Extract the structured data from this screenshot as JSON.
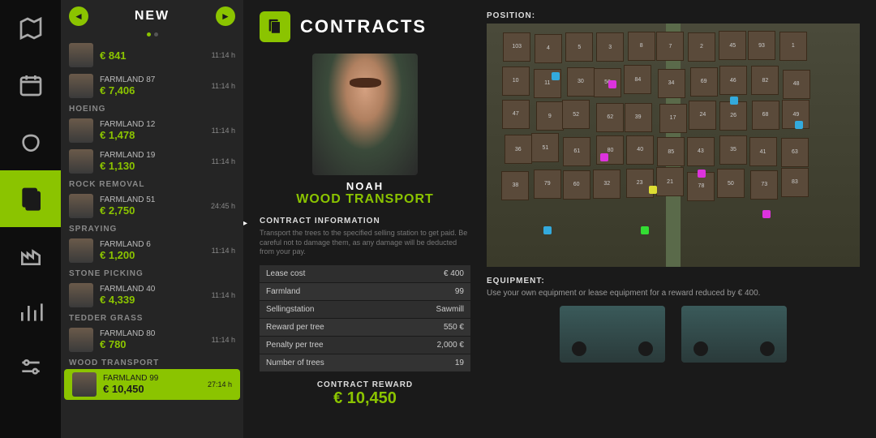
{
  "sidebar": {
    "title": "NEW",
    "categories": [
      {
        "name": "",
        "items": [
          {
            "farmland": "€ 841",
            "price": "",
            "time": "11:14 h",
            "hideName": true
          }
        ]
      },
      {
        "name": "",
        "items": [
          {
            "farmland": "FARMLAND 87",
            "price": "€ 7,406",
            "time": "11:14 h"
          }
        ]
      },
      {
        "name": "HOEING",
        "items": [
          {
            "farmland": "FARMLAND 12",
            "price": "€ 1,478",
            "time": "11:14 h"
          },
          {
            "farmland": "FARMLAND 19",
            "price": "€ 1,130",
            "time": "11:14 h"
          }
        ]
      },
      {
        "name": "ROCK REMOVAL",
        "items": [
          {
            "farmland": "FARMLAND 51",
            "price": "€ 2,750",
            "time": "24:45 h"
          }
        ]
      },
      {
        "name": "SPRAYING",
        "items": [
          {
            "farmland": "FARMLAND 6",
            "price": "€ 1,200",
            "time": "11:14 h"
          }
        ]
      },
      {
        "name": "STONE PICKING",
        "items": [
          {
            "farmland": "FARMLAND 40",
            "price": "€ 4,339",
            "time": "11:14 h"
          }
        ]
      },
      {
        "name": "TEDDER GRASS",
        "items": [
          {
            "farmland": "FARMLAND 80",
            "price": "€ 780",
            "time": "11:14 h"
          }
        ]
      },
      {
        "name": "WOOD TRANSPORT",
        "items": [
          {
            "farmland": "FARMLAND 99",
            "price": "€ 10,450",
            "time": "27:14 h",
            "selected": true
          }
        ]
      }
    ]
  },
  "page": {
    "title": "CONTRACTS"
  },
  "contract": {
    "npc": "NOAH",
    "job": "WOOD TRANSPORT",
    "info_heading": "CONTRACT INFORMATION",
    "description": "Transport the trees to the specified selling station to get paid. Be careful not to damage them, as any damage will be deducted from your pay.",
    "rows": [
      {
        "k": "Lease cost",
        "v": "€ 400"
      },
      {
        "k": "Farmland",
        "v": "99"
      },
      {
        "k": "Sellingstation",
        "v": "Sawmill"
      },
      {
        "k": "Reward per tree",
        "v": "550 €"
      },
      {
        "k": "Penalty per tree",
        "v": "2,000 €"
      },
      {
        "k": "Number of trees",
        "v": "19"
      }
    ],
    "reward_label": "CONTRACT REWARD",
    "reward_value": "€ 10,450"
  },
  "position": {
    "heading": "POSITION:"
  },
  "equipment": {
    "heading": "EQUIPMENT:",
    "text": "Use your own equipment or lease equipment for a reward reduced by € 400."
  },
  "plots": [
    "103",
    "4",
    "5",
    "3",
    "8",
    "7",
    "2",
    "45",
    "93",
    "1",
    "10",
    "11",
    "30",
    "56",
    "84",
    "34",
    "69",
    "46",
    "82",
    "48",
    "47",
    "9",
    "52",
    "62",
    "39",
    "17",
    "24",
    "26",
    "68",
    "49",
    "36",
    "51",
    "61",
    "80",
    "40",
    "85",
    "43",
    "35",
    "41",
    "63",
    "38",
    "79",
    "60",
    "32",
    "23",
    "21",
    "78",
    "50",
    "73",
    "83"
  ]
}
